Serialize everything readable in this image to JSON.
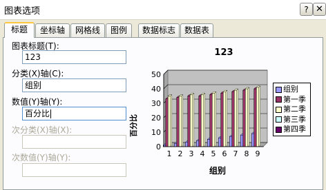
{
  "window": {
    "title": "图表选项",
    "help_label": "?",
    "close_label": "✕"
  },
  "tabs": [
    {
      "label": "标题",
      "active": true
    },
    {
      "label": "坐标轴"
    },
    {
      "label": "网格线"
    },
    {
      "label": "图例"
    },
    {
      "label": "数据标志"
    },
    {
      "label": "数据表"
    }
  ],
  "form": {
    "chart_title": {
      "label": "图表标题(T):",
      "value": "123"
    },
    "category_x": {
      "label": "分类(X)轴(C):",
      "value": "组别"
    },
    "value_y": {
      "label": "数值(Y)轴(Y):",
      "value": "百分比"
    },
    "secondary_category_x": {
      "label": "次分类(X)轴(X):",
      "value": ""
    },
    "secondary_value_y": {
      "label": "次数值(Y)轴(Y):",
      "value": ""
    }
  },
  "chart_data": {
    "type": "bar",
    "title": "123",
    "xlabel": "组别",
    "ylabel": "百分比",
    "categories": [
      "1",
      "2",
      "3",
      "4",
      "5",
      "6",
      "7",
      "8",
      "9"
    ],
    "ylim": [
      0,
      50
    ],
    "yticks": [
      0,
      10,
      20,
      30,
      40,
      50
    ],
    "series": [
      {
        "name": "组别",
        "color": "#9999ff",
        "values": [
          1,
          2,
          3,
          4,
          5,
          6,
          7,
          8,
          9
        ]
      },
      {
        "name": "第一季",
        "color": "#993366",
        "values": [
          33,
          34,
          35,
          35,
          36,
          37,
          38,
          39,
          40
        ]
      },
      {
        "name": "第二季",
        "color": "#ffffcc",
        "values": [
          35,
          35,
          36,
          36,
          37,
          38,
          39,
          40,
          41
        ]
      },
      {
        "name": "第三季",
        "color": "#ccffff",
        "values": [
          0,
          0,
          0,
          0,
          0,
          0,
          0,
          0,
          0
        ]
      },
      {
        "name": "第四季",
        "color": "#660066",
        "values": [
          0,
          0,
          0,
          0,
          0,
          0,
          0,
          0,
          0
        ]
      }
    ],
    "grid": true,
    "plot_background": "#c0c0c0",
    "legend_position": "right"
  }
}
